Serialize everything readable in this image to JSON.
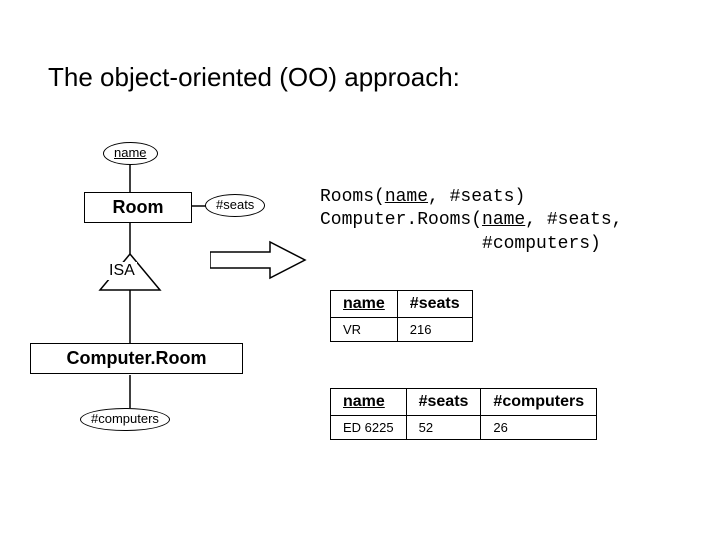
{
  "title": "The object-oriented (OO) approach:",
  "diagram": {
    "name_attr": "name",
    "room_entity": "Room",
    "seats_attr": "#seats",
    "isa_label": "ISA",
    "comproom_entity": "Computer.Room",
    "computers_attr": "#computers"
  },
  "schema": "Rooms(name, #seats)\nComputer.Rooms(name, #seats,\n               #computers)",
  "schema_parts": {
    "line1_a": "Rooms(",
    "line1_b": "name",
    "line1_c": ", #seats)",
    "line2_a": "Computer.Rooms(",
    "line2_b": "name",
    "line2_c": ", #seats,",
    "line3": "               #computers)"
  },
  "table1": {
    "headers": [
      "name",
      "#seats"
    ],
    "rows": [
      [
        "VR",
        "216"
      ]
    ]
  },
  "table2": {
    "headers": [
      "name",
      "#seats",
      "#computers"
    ],
    "rows": [
      [
        "ED 6225",
        "52",
        "26"
      ]
    ]
  },
  "chart_data": {
    "type": "diagram",
    "note": "ER/OO diagram with ISA hierarchy and resulting relational tables",
    "entities": [
      {
        "name": "Room",
        "attrs": [
          {
            "name": "name",
            "key": true
          },
          {
            "name": "#seats"
          }
        ]
      },
      {
        "name": "Computer.Room",
        "isa_parent": "Room",
        "attrs": [
          {
            "name": "#computers"
          }
        ]
      }
    ],
    "relational_schemas": [
      "Rooms(name, #seats)",
      "Computer.Rooms(name, #seats, #computers)"
    ],
    "instances": {
      "Rooms": [
        {
          "name": "VR",
          "#seats": 216
        }
      ],
      "Computer.Rooms": [
        {
          "name": "ED 6225",
          "#seats": 52,
          "#computers": 26
        }
      ]
    }
  }
}
